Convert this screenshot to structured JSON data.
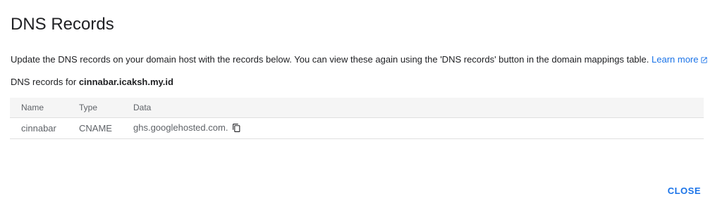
{
  "dialog": {
    "title": "DNS Records",
    "description": "Update the DNS records on your domain host with the records below. You can view these again using the 'DNS records' button in the domain mappings table.",
    "learn_more_label": " Learn more",
    "records_for_prefix": "DNS records for ",
    "domain": "cinnabar.icaksh.my.id",
    "close_label": "CLOSE",
    "accent_color": "#1a73e8"
  },
  "table": {
    "headers": [
      "Name",
      "Type",
      "Data"
    ],
    "rows": [
      {
        "name": "cinnabar",
        "type": "CNAME",
        "data": "ghs.googlehosted.com.",
        "action_icon": "copy-icon"
      }
    ]
  }
}
